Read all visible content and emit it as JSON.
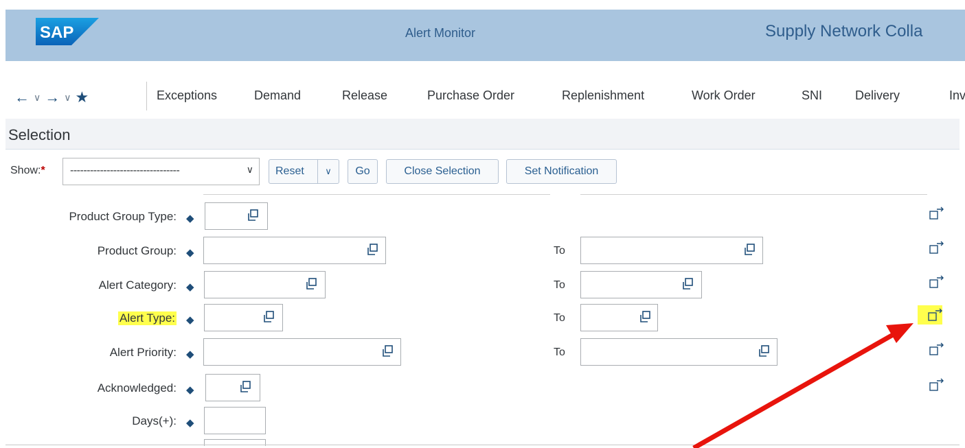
{
  "shell": {
    "logo_text": "SAP",
    "title": "Alert Monitor",
    "app_title": "Supply Network Colla"
  },
  "toolbar": {
    "nav_icons": [
      "back-arrow-icon",
      "chevron-down-icon",
      "forward-arrow-icon",
      "chevron-down-icon",
      "favorite-star-icon"
    ],
    "menu": [
      "Exceptions",
      "Demand",
      "Release",
      "Purchase Order",
      "Replenishment",
      "Work Order",
      "SNI",
      "Delivery",
      "Inv"
    ]
  },
  "selection": {
    "title": "Selection",
    "show_label": "Show:",
    "show_required_marker": "*",
    "show_value": "---------------------------------",
    "buttons": {
      "reset": "Reset",
      "go": "Go",
      "close_selection": "Close Selection",
      "set_notification": "Set Notification"
    },
    "to_label": "To",
    "fields": [
      {
        "label": "Product Group Type:",
        "has_to": false
      },
      {
        "label": "Product Group:",
        "has_to": true
      },
      {
        "label": "Alert Category:",
        "has_to": true
      },
      {
        "label": "Alert Type:",
        "has_to": true
      },
      {
        "label": "Alert Priority:",
        "has_to": true
      },
      {
        "label": "Acknowledged:",
        "has_to": false
      },
      {
        "label": "Days(+):",
        "has_to": false
      }
    ]
  },
  "colors": {
    "shellbar": "#a9c5df",
    "highlight": "#ffff4d",
    "annotation_arrow": "#e8140c",
    "brand_blue": "#1f4e79"
  }
}
